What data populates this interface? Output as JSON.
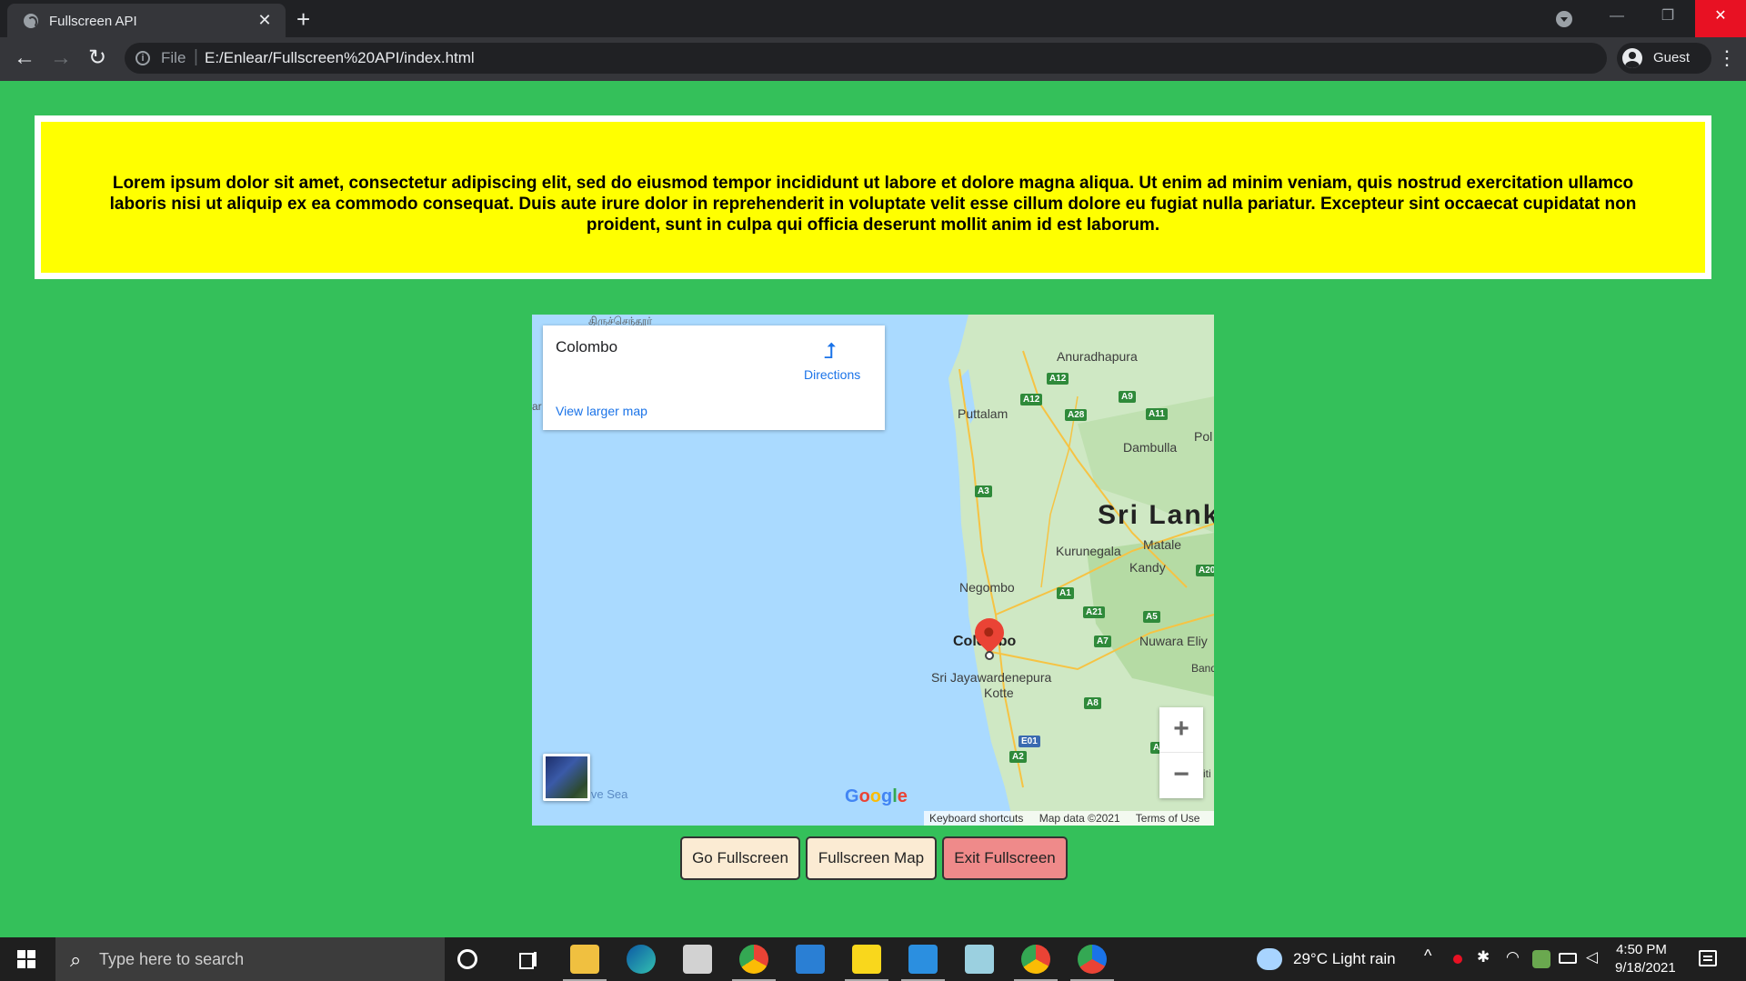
{
  "browser": {
    "tab_title": "Fullscreen API",
    "tab_close": "✕",
    "new_tab": "+",
    "window_min": "—",
    "window_restore": "❐",
    "window_close": "✕",
    "back": "←",
    "forward": "→",
    "reload": "↻",
    "scheme": "File",
    "separator": "|",
    "url": "E:/Enlear/Fullscreen%20API/index.html",
    "profile": "Guest",
    "menu": "⋮",
    "info_glyph": "i"
  },
  "page": {
    "lorem": "Lorem ipsum dolor sit amet, consectetur adipiscing elit, sed do eiusmod tempor incididunt ut labore et dolore magna aliqua. Ut enim ad minim veniam, quis nostrud exercitation ullamco laboris nisi ut aliquip ex ea commodo consequat. Duis aute irure dolor in reprehenderit in voluptate velit esse cillum dolore eu fugiat nulla pariatur. Excepteur sint occaecat cupidatat non proident, sunt in culpa qui officia deserunt mollit anim id est laborum."
  },
  "map": {
    "place_name": "Colombo",
    "directions_label": "Directions",
    "view_larger": "View larger map",
    "zoom_in": "+",
    "zoom_out": "−",
    "google": "Google",
    "keyboard_shortcuts": "Keyboard shortcuts",
    "map_data": "Map data ©2021",
    "terms": "Terms of Use",
    "labels": {
      "tam_top": "திருச்செந்தூர்",
      "tam_left": "ar\nதமரி",
      "anuradhapura": "Anuradhapura",
      "puttalam": "Puttalam",
      "dambulla": "Dambulla",
      "pol": "Pol",
      "sri_lanka": "Sri Lank",
      "kurunegala": "Kurunegala",
      "matale": "Matale",
      "kandy": "Kandy",
      "negombo": "Negombo",
      "colombo": "Colombo",
      "sjk": "Sri Jayawardenepura",
      "kotte": "Kotte",
      "nuwara": "Nuwara Eliy",
      "ban": "Band",
      "sea": "ive Sea",
      "iti": "iti"
    },
    "roads": [
      "A12",
      "A9",
      "A12",
      "A28",
      "A11",
      "A3",
      "A20",
      "A1",
      "A21",
      "A5",
      "A7",
      "A8",
      "E01",
      "A2",
      "A"
    ]
  },
  "buttons": {
    "go_fullscreen": "Go Fullscreen",
    "fullscreen_map": "Fullscreen Map",
    "exit_fullscreen": "Exit Fullscreen"
  },
  "taskbar": {
    "search_placeholder": "Type here to search",
    "weather": "29°C  Light rain",
    "time": "4:50 PM",
    "date": "9/18/2021"
  }
}
